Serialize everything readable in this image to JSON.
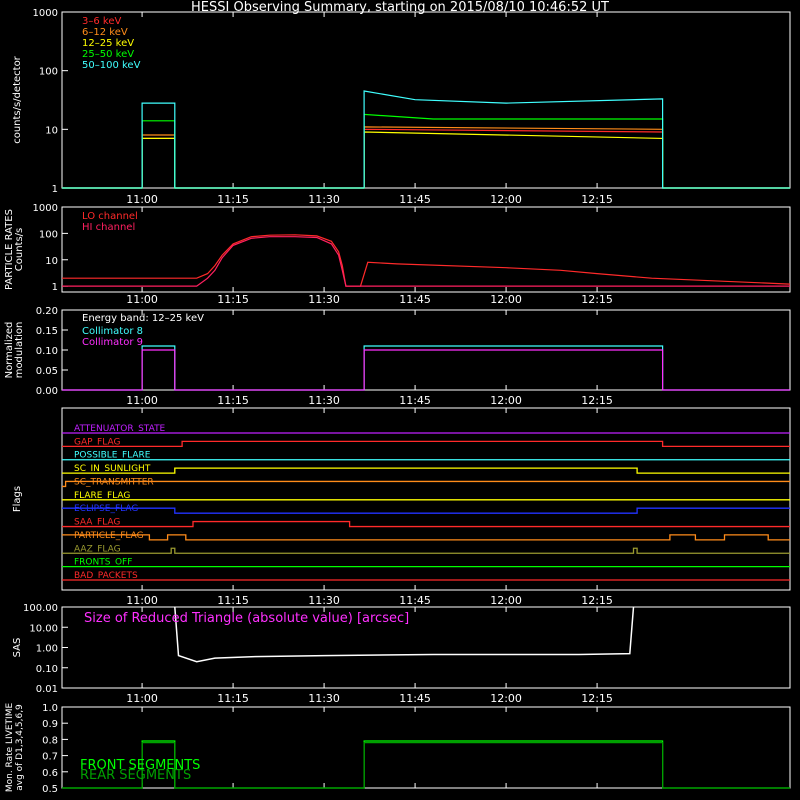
{
  "title": "HESSI Observing Summary, starting on 2015/08/10 10:46:52 UT",
  "time_ticks": [
    "11:00",
    "11:15",
    "11:30",
    "11:45",
    "12:00",
    "12:15"
  ],
  "colors": {
    "red": "#ff2a2a",
    "orange": "#ff8c1a",
    "yellow": "#ffff00",
    "green": "#00ff00",
    "cyan": "#40ffff",
    "magenta": "#ff30ff",
    "white": "#ffffff",
    "blue": "#2233ff",
    "darkgreen": "#00a000",
    "olive": "#9a9a30",
    "purple": "#c020ff",
    "crimson": "#ff2060"
  },
  "chart_data": [
    {
      "id": "count_rates",
      "type": "line",
      "ylabel": "counts/s/detector",
      "yscale": "log",
      "ylim": [
        1,
        1000
      ],
      "ytick_labels": [
        "1",
        "10",
        "100",
        "1000"
      ],
      "series": [
        {
          "name": "3–6 keV",
          "color": "#ff2a2a",
          "points": [
            [
              10.78,
              1
            ],
            [
              11.0,
              1
            ],
            [
              11.0,
              7
            ],
            [
              11.09,
              7
            ],
            [
              11.09,
              1
            ],
            [
              11.61,
              1
            ],
            [
              11.61,
              10
            ],
            [
              12.43,
              9
            ],
            [
              12.43,
              1
            ],
            [
              12.78,
              1
            ]
          ]
        },
        {
          "name": "6–12 keV",
          "color": "#ff8c1a",
          "points": [
            [
              10.78,
              1
            ],
            [
              11.0,
              1
            ],
            [
              11.0,
              8
            ],
            [
              11.09,
              8
            ],
            [
              11.09,
              1
            ],
            [
              11.61,
              1
            ],
            [
              11.61,
              11
            ],
            [
              12.43,
              10
            ],
            [
              12.43,
              1
            ],
            [
              12.78,
              1
            ]
          ]
        },
        {
          "name": "12–25 keV",
          "color": "#ffff00",
          "points": [
            [
              10.78,
              1
            ],
            [
              11.0,
              1
            ],
            [
              11.0,
              7
            ],
            [
              11.09,
              7
            ],
            [
              11.09,
              1
            ],
            [
              11.61,
              1
            ],
            [
              11.61,
              9
            ],
            [
              12.43,
              7
            ],
            [
              12.43,
              1
            ],
            [
              12.78,
              1
            ]
          ]
        },
        {
          "name": "25–50 keV",
          "color": "#00ff00",
          "points": [
            [
              10.78,
              1
            ],
            [
              11.0,
              1
            ],
            [
              11.0,
              14
            ],
            [
              11.09,
              14
            ],
            [
              11.09,
              1
            ],
            [
              11.61,
              1
            ],
            [
              11.61,
              18
            ],
            [
              11.8,
              15
            ],
            [
              12.43,
              15
            ],
            [
              12.43,
              1
            ],
            [
              12.78,
              1
            ]
          ]
        },
        {
          "name": "50–100 keV",
          "color": "#40ffff",
          "points": [
            [
              10.78,
              1
            ],
            [
              11.0,
              1
            ],
            [
              11.0,
              28
            ],
            [
              11.09,
              28
            ],
            [
              11.09,
              1
            ],
            [
              11.61,
              1
            ],
            [
              11.61,
              45
            ],
            [
              11.75,
              32
            ],
            [
              12.0,
              28
            ],
            [
              12.43,
              33
            ],
            [
              12.43,
              1
            ],
            [
              12.78,
              1
            ]
          ]
        }
      ]
    },
    {
      "id": "particle_rates",
      "type": "line",
      "ylabel": "PARTICLE RATES Counts/s",
      "yscale": "log",
      "ylim": [
        0.6,
        1000
      ],
      "ytick_labels": [
        "1",
        "10",
        "100",
        "1000"
      ],
      "series": [
        {
          "name": "LO channel",
          "color": "#ff2a2a",
          "points": [
            [
              10.78,
              2
            ],
            [
              11.15,
              2
            ],
            [
              11.18,
              3
            ],
            [
              11.2,
              6
            ],
            [
              11.22,
              15
            ],
            [
              11.25,
              40
            ],
            [
              11.3,
              75
            ],
            [
              11.35,
              85
            ],
            [
              11.42,
              88
            ],
            [
              11.48,
              80
            ],
            [
              11.52,
              50
            ],
            [
              11.54,
              20
            ],
            [
              11.55,
              6
            ],
            [
              11.56,
              1
            ],
            [
              11.6,
              1
            ],
            [
              11.62,
              8
            ],
            [
              11.7,
              7
            ],
            [
              12.0,
              5
            ],
            [
              12.15,
              4
            ],
            [
              12.25,
              3
            ],
            [
              12.4,
              2
            ],
            [
              12.78,
              1.2
            ]
          ]
        },
        {
          "name": "HI channel",
          "color": "#ff2060",
          "points": [
            [
              10.78,
              1
            ],
            [
              11.15,
              1
            ],
            [
              11.18,
              2
            ],
            [
              11.2,
              4
            ],
            [
              11.22,
              12
            ],
            [
              11.25,
              35
            ],
            [
              11.3,
              65
            ],
            [
              11.35,
              75
            ],
            [
              11.42,
              75
            ],
            [
              11.48,
              70
            ],
            [
              11.52,
              40
            ],
            [
              11.54,
              15
            ],
            [
              11.55,
              4
            ],
            [
              11.56,
              1
            ],
            [
              12.78,
              1
            ]
          ]
        }
      ]
    },
    {
      "id": "modulation",
      "type": "line",
      "ylabel": "Normalized modulation",
      "ylim": [
        0,
        0.2
      ],
      "ytick_labels": [
        "0.00",
        "0.05",
        "0.10",
        "0.15",
        "0.20"
      ],
      "annotations": [
        "Energy band: 12–25 keV"
      ],
      "series": [
        {
          "name": "Collimator 8",
          "color": "#40ffff",
          "points": [
            [
              10.78,
              0
            ],
            [
              11.0,
              0
            ],
            [
              11.0,
              0.11
            ],
            [
              11.09,
              0.11
            ],
            [
              11.09,
              0
            ],
            [
              11.61,
              0
            ],
            [
              11.61,
              0.11
            ],
            [
              12.43,
              0.11
            ],
            [
              12.43,
              0
            ],
            [
              12.78,
              0
            ]
          ]
        },
        {
          "name": "Collimator 9",
          "color": "#ff30ff",
          "points": [
            [
              10.78,
              0
            ],
            [
              11.0,
              0
            ],
            [
              11.0,
              0.1
            ],
            [
              11.09,
              0.1
            ],
            [
              11.09,
              0
            ],
            [
              11.61,
              0
            ],
            [
              11.61,
              0.1
            ],
            [
              12.43,
              0.1
            ],
            [
              12.43,
              0
            ],
            [
              12.78,
              0
            ]
          ]
        }
      ]
    },
    {
      "id": "flags",
      "type": "line",
      "ylabel": "Flags",
      "flags": [
        {
          "name": "ATTENUATOR_STATE",
          "color": "#c020ff",
          "transitions": [
            [
              10.78,
              0
            ]
          ]
        },
        {
          "name": "GAP_FLAG",
          "color": "#ff2a2a",
          "transitions": [
            [
              10.78,
              0
            ],
            [
              11.11,
              1
            ],
            [
              12.43,
              0
            ]
          ]
        },
        {
          "name": "POSSIBLE_FLARE",
          "color": "#40ffff",
          "transitions": [
            [
              10.78,
              0
            ]
          ]
        },
        {
          "name": "SC_IN_SUNLIGHT",
          "color": "#ffff00",
          "transitions": [
            [
              10.78,
              0
            ],
            [
              11.09,
              1
            ],
            [
              12.36,
              0
            ]
          ]
        },
        {
          "name": "SC_TRANSMITTER",
          "color": "#ff8c1a",
          "transitions": [
            [
              10.78,
              0
            ],
            [
              10.79,
              1
            ]
          ]
        },
        {
          "name": "FLARE_FLAG",
          "color": "#ffff00",
          "transitions": [
            [
              10.78,
              0
            ]
          ]
        },
        {
          "name": "ECLIPSE_FLAG",
          "color": "#2233ff",
          "transitions": [
            [
              10.78,
              1
            ],
            [
              11.09,
              0
            ],
            [
              12.36,
              1
            ]
          ]
        },
        {
          "name": "SAA_FLAG",
          "color": "#ff2a2a",
          "transitions": [
            [
              10.78,
              0
            ],
            [
              11.14,
              1
            ],
            [
              11.57,
              0
            ]
          ]
        },
        {
          "name": "PARTICLE_FLAG",
          "color": "#ff8c1a",
          "transitions": [
            [
              10.78,
              1
            ],
            [
              11.02,
              0
            ],
            [
              11.07,
              1
            ],
            [
              11.12,
              0
            ],
            [
              12.45,
              1
            ],
            [
              12.52,
              0
            ],
            [
              12.6,
              1
            ],
            [
              12.72,
              0
            ]
          ]
        },
        {
          "name": "AAZ_FLAG",
          "color": "#9a9a30",
          "transitions": [
            [
              10.78,
              0
            ],
            [
              11.08,
              1
            ],
            [
              11.09,
              0
            ],
            [
              12.35,
              1
            ],
            [
              12.36,
              0
            ]
          ]
        },
        {
          "name": "FRONTS_OFF",
          "color": "#00ff00",
          "transitions": [
            [
              10.78,
              0
            ]
          ]
        },
        {
          "name": "BAD_PACKETS",
          "color": "#ff2a2a",
          "transitions": [
            [
              10.78,
              0
            ]
          ]
        }
      ]
    },
    {
      "id": "sas",
      "type": "line",
      "title": "Size of Reduced Triangle (absolute value) [arcsec]",
      "ylabel": "SAS",
      "yscale": "log",
      "ylim": [
        0.01,
        100
      ],
      "ytick_labels": [
        "0.01",
        "0.10",
        "1.00",
        "10.00",
        "100.00"
      ],
      "series": [
        {
          "name": "",
          "color": "#ffffff",
          "points": [
            [
              11.09,
              100
            ],
            [
              11.1,
              0.4
            ],
            [
              11.15,
              0.2
            ],
            [
              11.2,
              0.3
            ],
            [
              11.3,
              0.35
            ],
            [
              11.5,
              0.4
            ],
            [
              11.8,
              0.45
            ],
            [
              12.0,
              0.45
            ],
            [
              12.2,
              0.45
            ],
            [
              12.34,
              0.5
            ],
            [
              12.35,
              100
            ]
          ]
        }
      ]
    },
    {
      "id": "livetime",
      "type": "line",
      "ylabel": "Mon. Rate LIVETIME avg of D1,3,4,5,6,9",
      "ylim": [
        0.5,
        1.0
      ],
      "ytick_labels": [
        "0.5",
        "0.6",
        "0.7",
        "0.8",
        "0.9",
        "1.0"
      ],
      "series": [
        {
          "name": "FRONT SEGMENTS",
          "color": "#00ff00",
          "points": [
            [
              10.78,
              0.5
            ],
            [
              11.0,
              0.5
            ],
            [
              11.0,
              0.79
            ],
            [
              11.09,
              0.79
            ],
            [
              11.09,
              0.5
            ],
            [
              11.61,
              0.5
            ],
            [
              11.61,
              0.79
            ],
            [
              12.43,
              0.79
            ],
            [
              12.43,
              0.5
            ],
            [
              12.78,
              0.5
            ]
          ]
        },
        {
          "name": "REAR SEGMENTS",
          "color": "#00a000",
          "points": [
            [
              10.78,
              0.5
            ],
            [
              11.0,
              0.5
            ],
            [
              11.0,
              0.78
            ],
            [
              11.09,
              0.78
            ],
            [
              11.09,
              0.5
            ],
            [
              11.61,
              0.5
            ],
            [
              11.61,
              0.78
            ],
            [
              12.43,
              0.78
            ],
            [
              12.43,
              0.5
            ],
            [
              12.78,
              0.5
            ]
          ]
        }
      ]
    }
  ]
}
